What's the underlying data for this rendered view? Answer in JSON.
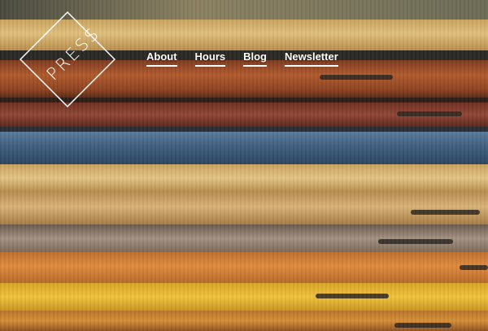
{
  "brand": {
    "logo_text": "PRESS"
  },
  "nav": [
    {
      "label": "About"
    },
    {
      "label": "Hours"
    },
    {
      "label": "Blog"
    },
    {
      "label": "Newsletter"
    }
  ],
  "colors": {
    "nav_text": "#ffffff",
    "logo_stroke": "#ffffff"
  },
  "hero_image": {
    "subject": "stack-of-worn-book-spines",
    "icon": "photo"
  }
}
